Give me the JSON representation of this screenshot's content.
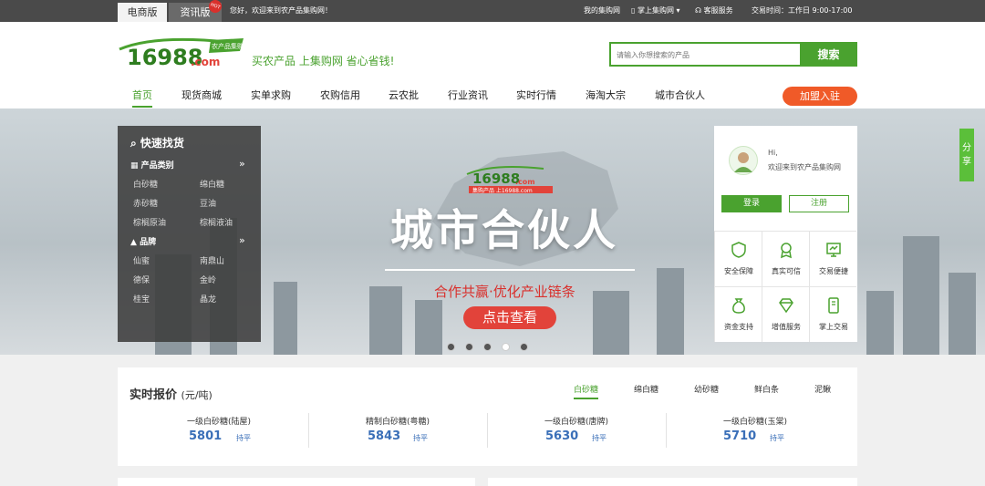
{
  "topbar": {
    "tabs": [
      "电商版",
      "资讯版"
    ],
    "hot_badge": "HOT",
    "welcome": "您好，欢迎来到农产品集购网！",
    "my_site": "我的集购网",
    "mobile": "掌上集购网",
    "service": "客服服务",
    "hours": "交易时间：工作日 9:00-17:00"
  },
  "header": {
    "logo_num": "16988",
    "logo_com": ".com",
    "logo_tag": "农产品集购网",
    "slogan": "买农产品  上集购网  省心省钱!",
    "search_placeholder": "请输入你想搜索的产品",
    "search_button": "搜索"
  },
  "nav": {
    "items": [
      "首页",
      "现货商城",
      "实单求购",
      "农购信用",
      "云农批",
      "行业资讯",
      "实时行情",
      "海淘大宗",
      "城市合伙人"
    ],
    "join": "加盟入驻"
  },
  "quick": {
    "title": "快速找货",
    "cat_title": "产品类别",
    "cat_items": [
      "白砂糖",
      "绵白糖",
      "赤砂糖",
      "豆油",
      "棕榈原油",
      "棕榈液油"
    ],
    "brand_title": "品牌",
    "brand_items": [
      "仙蜜",
      "南鼎山",
      "德保",
      "金岭",
      "桂宝",
      "晶龙"
    ],
    "more": "»"
  },
  "banner": {
    "logo_num": "16988",
    "logo_com": ".com",
    "logo_sub": "集购产品  上16988.com",
    "title": "城市合伙人",
    "subtitle": "合作共赢·优化产业链条",
    "button": "点击查看",
    "active_slide": 4,
    "slides": 5
  },
  "user": {
    "hi": "Hi,",
    "welcome": "欢迎来到农产品集购网",
    "login": "登录",
    "register": "注册",
    "features": [
      "安全保障",
      "真实可信",
      "交易便捷",
      "资金支持",
      "增值服务",
      "掌上交易"
    ]
  },
  "share": "分享",
  "prices": {
    "title": "实时报价",
    "unit": "(元/吨)",
    "tabs": [
      "白砂糖",
      "绵白糖",
      "幼砂糖",
      "鲜白条",
      "泥鳅"
    ],
    "items": [
      {
        "name": "一级白砂糖(陆屋)",
        "price": "5801",
        "trend": "持平"
      },
      {
        "name": "精制白砂糖(粤糖)",
        "price": "5843",
        "trend": "持平"
      },
      {
        "name": "一级白砂糖(唐牌)",
        "price": "5630",
        "trend": "持平"
      },
      {
        "name": "一级白砂糖(玉棠)",
        "price": "5710",
        "trend": "持平"
      }
    ]
  },
  "colors": {
    "brand_green": "#4aa22f",
    "orange": "#f05a28",
    "red": "#e2433a",
    "price_blue": "#3a6fb8"
  }
}
